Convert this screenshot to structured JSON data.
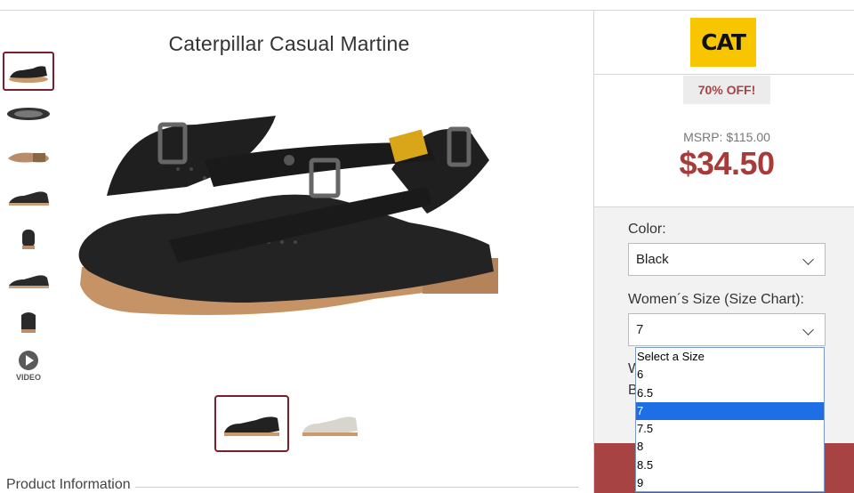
{
  "product": {
    "title": "Caterpillar Casual Martine",
    "video_label": "VIDEO",
    "info_heading": "Product Information"
  },
  "brand": {
    "logo_text": "CAT",
    "color": "#f7c600"
  },
  "pricing": {
    "discount": "70% OFF!",
    "msrp": "MSRP: $115.00",
    "price": "$34.50",
    "price_color": "#a83a3a"
  },
  "options": {
    "color_label": "Color:",
    "color_value": "Black",
    "size_label": "Women´s Size (Size Chart):",
    "size_value": "7",
    "behind_text_1": "W",
    "behind_text_2": "B",
    "size_options": [
      "Select a Size",
      "6",
      "6.5",
      "7",
      "7.5",
      "8",
      "8.5",
      "9"
    ],
    "selected_index": 3
  },
  "thumbnails": {
    "side": [
      "shoe-side-black",
      "shoe-top-black",
      "shoe-sole",
      "shoe-side-black-2",
      "shoe-front",
      "shoe-side-black-3",
      "shoe-back"
    ],
    "bottom": [
      "shoe-black",
      "shoe-white"
    ]
  }
}
